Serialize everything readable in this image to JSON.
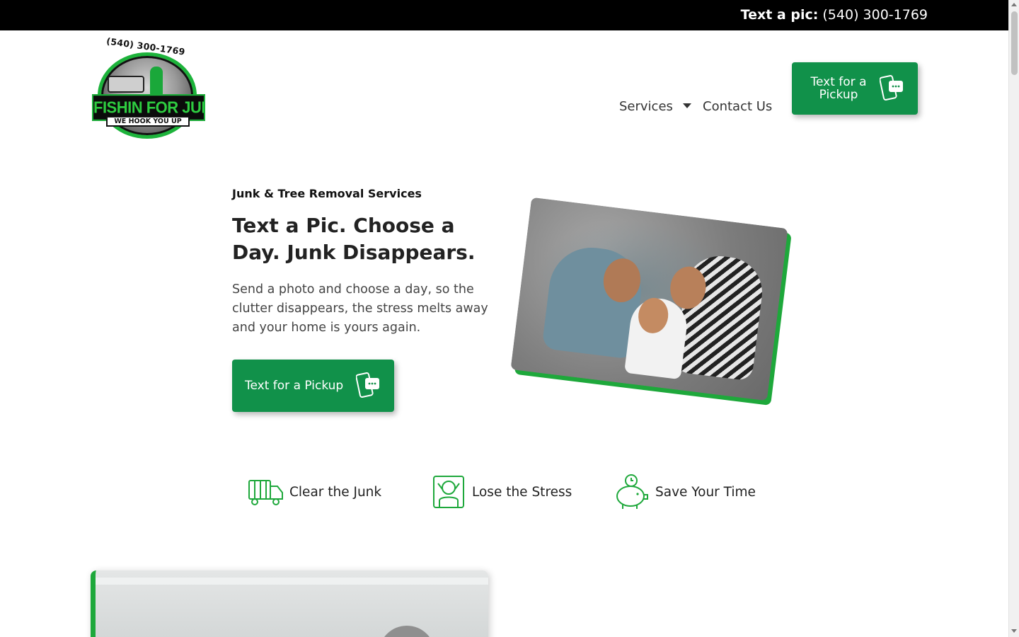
{
  "topbar": {
    "label": "Text a pic:",
    "phone": "(540) 300-1769"
  },
  "logo": {
    "phone": "(540) 300-1769",
    "name": "FISHIN FOR JUNK LLC",
    "tagline": "WE HOOK YOU UP"
  },
  "nav": {
    "services": "Services",
    "contact": "Contact Us"
  },
  "header_cta": {
    "label": "Text for a Pickup",
    "icon": "message-phone-icon"
  },
  "hero": {
    "eyebrow": "Junk & Tree Removal Services",
    "headline": "Text a Pic. Choose a Day. Junk Disappears.",
    "lead": "Send a photo and choose a day, so the clutter disappears, the stress melts away and your home is yours again.",
    "cta_label": "Text for a Pickup",
    "cta_icon": "message-phone-icon",
    "image": "family-lying-on-carpet-photo"
  },
  "features": [
    {
      "label": "Clear the Junk",
      "icon": "truck-icon"
    },
    {
      "label": "Lose the Stress",
      "icon": "relaxed-person-icon"
    },
    {
      "label": "Save Your Time",
      "icon": "piggy-bank-clock-icon"
    }
  ],
  "colors": {
    "brand_green": "#11914a",
    "accent_green": "#1ea83b",
    "topbar_bg": "#000000"
  }
}
